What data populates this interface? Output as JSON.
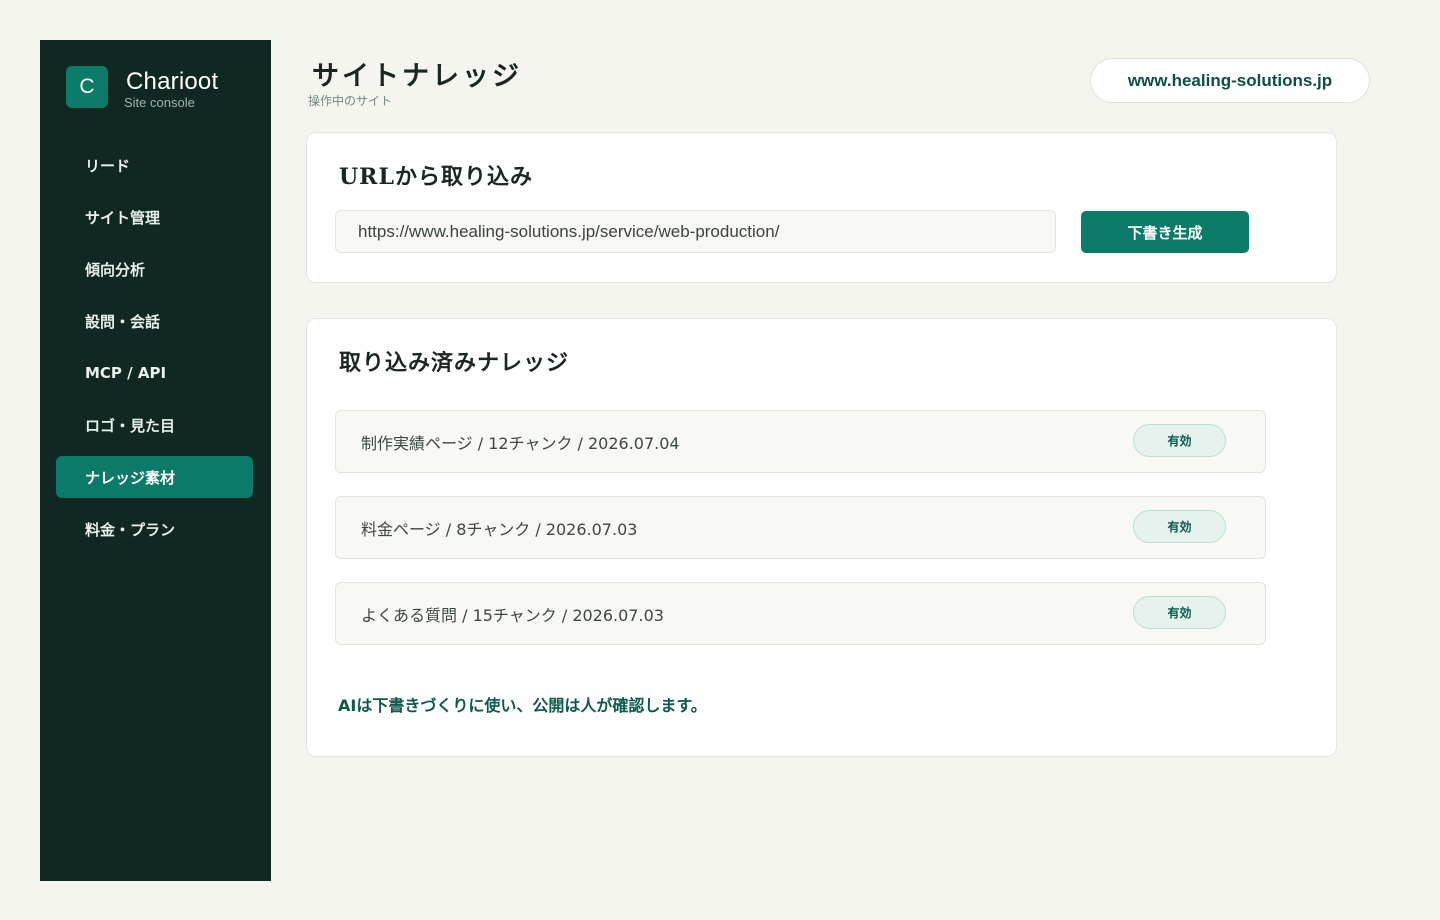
{
  "brand": {
    "logo_letter": "C",
    "name": "Charioot",
    "subtitle": "Site console"
  },
  "sidebar": {
    "items": [
      {
        "label": "リード",
        "active": false
      },
      {
        "label": "サイト管理",
        "active": false
      },
      {
        "label": "傾向分析",
        "active": false
      },
      {
        "label": "設問・会話",
        "active": false
      },
      {
        "label": "MCP / API",
        "active": false
      },
      {
        "label": "ロゴ・見た目",
        "active": false
      },
      {
        "label": "ナレッジ素材",
        "active": true
      },
      {
        "label": "料金・プラン",
        "active": false
      }
    ]
  },
  "header": {
    "title": "サイトナレッジ",
    "subtitle": "操作中のサイト",
    "site": "www.healing-solutions.jp"
  },
  "import_card": {
    "title": "URLから取り込み",
    "url_value": "https://www.healing-solutions.jp/service/web-production/",
    "button_label": "下書き生成"
  },
  "knowledge_card": {
    "title": "取り込み済みナレッジ",
    "items": [
      {
        "text": "制作実績ページ / 12チャンク / 2026.07.04",
        "status": "有効"
      },
      {
        "text": "料金ページ / 8チャンク / 2026.07.03",
        "status": "有効"
      },
      {
        "text": "よくある質問 / 15チャンク / 2026.07.03",
        "status": "有効"
      }
    ],
    "note": "AIは下書きづくりに使い、公開は人が確認します。"
  },
  "colors": {
    "accent": "#0b7a68",
    "sidebar_bg": "#112722",
    "page_bg": "#f5f5f0",
    "badge_bg": "#e5f2ee"
  }
}
